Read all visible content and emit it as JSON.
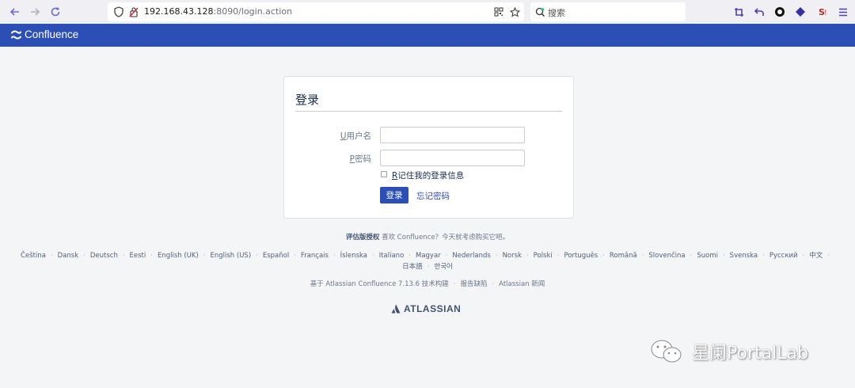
{
  "browser": {
    "url_host": "192.168.43.128",
    "url_rest": ":8090/login.action",
    "search_placeholder": "搜索"
  },
  "header": {
    "app_name": "Confluence"
  },
  "login": {
    "title": "登录",
    "username_label_key": "U",
    "username_label": "用户名",
    "password_label_key": "P",
    "password_label": "密码",
    "username_value": "",
    "password_value": "",
    "remember_key": "R",
    "remember_label": "记住我的登录信息",
    "remember_checked": false,
    "submit_label": "登录",
    "forgot_label": "忘记密码"
  },
  "footer": {
    "eval_bold": "评估版授权",
    "eval_text": " 喜欢 Confluence？今天就考虑购买它吧。",
    "languages_row1": [
      "Čeština",
      "Dansk",
      "Deutsch",
      "Eesti",
      "English (UK)",
      "English (US)",
      "Español",
      "Français",
      "Íslenska",
      "Italiano",
      "Magyar",
      "Nederlands",
      "Norsk",
      "Polski",
      "Português",
      "Română",
      "Slovenčina",
      "Suomi",
      "Svenska",
      "Русский",
      "中文"
    ],
    "languages_row2": [
      "日本語",
      "한국어"
    ],
    "powered_by": "基于 Atlassian Confluence 7.13.6 技术构建",
    "report_bug": "报告缺陷",
    "atlassian_news": "Atlassian 新闻",
    "atlassian_logo": "ATLASSIAN"
  },
  "watermark": {
    "text": "星阑PortalLab"
  },
  "colors": {
    "brand_blue": "#2b4fb5",
    "page_bg": "#f4f5f7"
  }
}
